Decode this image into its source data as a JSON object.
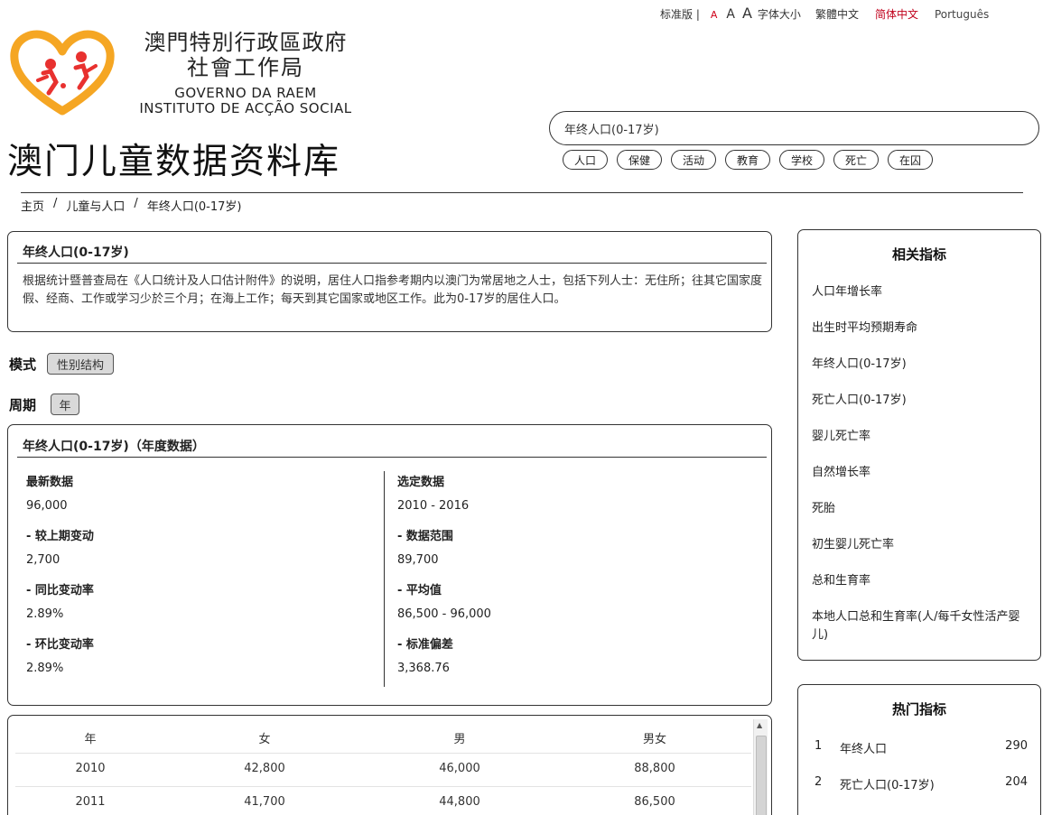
{
  "topbar": {
    "standard": "标准版 |",
    "font_a_small": "A",
    "font_a_mid": "A",
    "font_a_large": "A",
    "font_size_label": "字体大小",
    "traditional": "繁體中文",
    "simplified": "简体中文",
    "portuguese": "Português"
  },
  "org": {
    "cn_line1": "澳門特別行政區政府",
    "cn_line2": "社會工作局",
    "pt_line1": "GOVERNO DA RAEM",
    "pt_line2": "INSTITUTO DE ACÇÃO SOCIAL"
  },
  "site_title": "澳门儿童数据资料库",
  "search": {
    "value": "年终人口(0-17岁)"
  },
  "tags": [
    "人口",
    "保健",
    "活动",
    "教育",
    "学校",
    "死亡",
    "在囚"
  ],
  "breadcrumb": [
    "主页",
    "儿童与人口",
    "年终人口(0-17岁)"
  ],
  "description": {
    "title": "年终人口(0-17岁)",
    "text": "根据统计暨普查局在《人口统计及人口估计附件》的说明，居住人口指参考期内以澳门为常居地之人士，包括下列人士：无住所；往其它国家度假、经商、工作或学习少於三个月；在海上工作；每天到其它国家或地区工作。此为0-17岁的居住人口。"
  },
  "mode": {
    "label": "模式",
    "button": "性别结构"
  },
  "period": {
    "label": "周期",
    "button": "年"
  },
  "annual": {
    "title": "年终人口(0-17岁)（年度数据）",
    "latest_label": "最新数据",
    "latest_value": "96,000",
    "change_label": "- 较上期变动",
    "change_value": "2,700",
    "yoy_label": "- 同比变动率",
    "yoy_value": "2.89%",
    "mom_label": "- 环比变动率",
    "mom_value": "2.89%",
    "selected_label": "选定数据",
    "selected_value": "2010 - 2016",
    "range_label": "- 数据范围",
    "range_value": "89,700",
    "mean_label": "- 平均值",
    "mean_value": "86,500 - 96,000",
    "sd_label": "- 标准偏差",
    "sd_value": "3,368.76"
  },
  "table": {
    "headers": [
      "年",
      "女",
      "男",
      "男女"
    ],
    "rows": [
      [
        "2010",
        "42,800",
        "46,000",
        "88,800"
      ],
      [
        "2011",
        "41,700",
        "44,800",
        "86,500"
      ]
    ]
  },
  "related": {
    "title": "相关指标",
    "items": [
      "人口年增长率",
      "出生时平均预期寿命",
      "年终人口(0-17岁)",
      "死亡人口(0-17岁)",
      "婴儿死亡率",
      "自然增长率",
      "死胎",
      "初生婴儿死亡率",
      "总和生育率",
      "本地人口总和生育率(人/每千女性活产婴儿)"
    ]
  },
  "hot": {
    "title": "热门指标",
    "items": [
      {
        "rank": "1",
        "name": "年终人口",
        "count": "290"
      },
      {
        "rank": "2",
        "name": "死亡人口(0-17岁)",
        "count": "204"
      }
    ]
  },
  "colors": {
    "accent_red": "#d0021b",
    "logo_orange": "#f5a623",
    "logo_red": "#e8312f"
  }
}
